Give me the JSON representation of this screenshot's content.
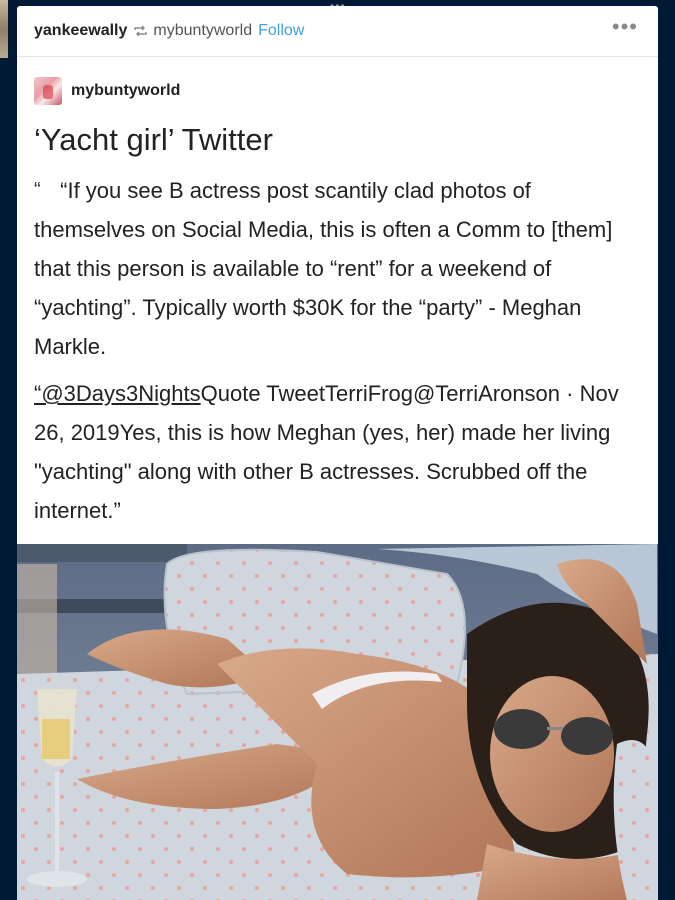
{
  "header": {
    "username": "yankeewally",
    "source_blog": "mybuntyworld",
    "follow_label": "Follow",
    "menu_glyph": "•••"
  },
  "top_handle_glyph": "•••",
  "post": {
    "blog_name": "mybuntyworld",
    "title": "‘Yacht girl’ Twitter",
    "open_quote": "“",
    "paragraph_1": "“If you see B actress post scantily clad photos of themselves on Social Media, this is often a Comm to [them] that this person is available to “rent” for a weekend of “yachting”. Typically worth $30K for the “party” - Meghan Markle.",
    "paragraph_2_link": "“@3Days3Nights",
    "paragraph_2_rest": "Quote TweetTerriFrog@TerriAronson · Nov 26, 2019Yes, this is how Meghan (yes, her) made her living \"yachting\" along with other B actresses. Scrubbed off the internet.”"
  },
  "icons": {
    "reblog": "reblog-icon",
    "menu": "more-options-icon",
    "avatar": "blog-avatar"
  },
  "colors": {
    "page_background": "#001935",
    "card_background": "#ffffff",
    "follow_link": "#3ea1e0",
    "text": "#222222"
  }
}
